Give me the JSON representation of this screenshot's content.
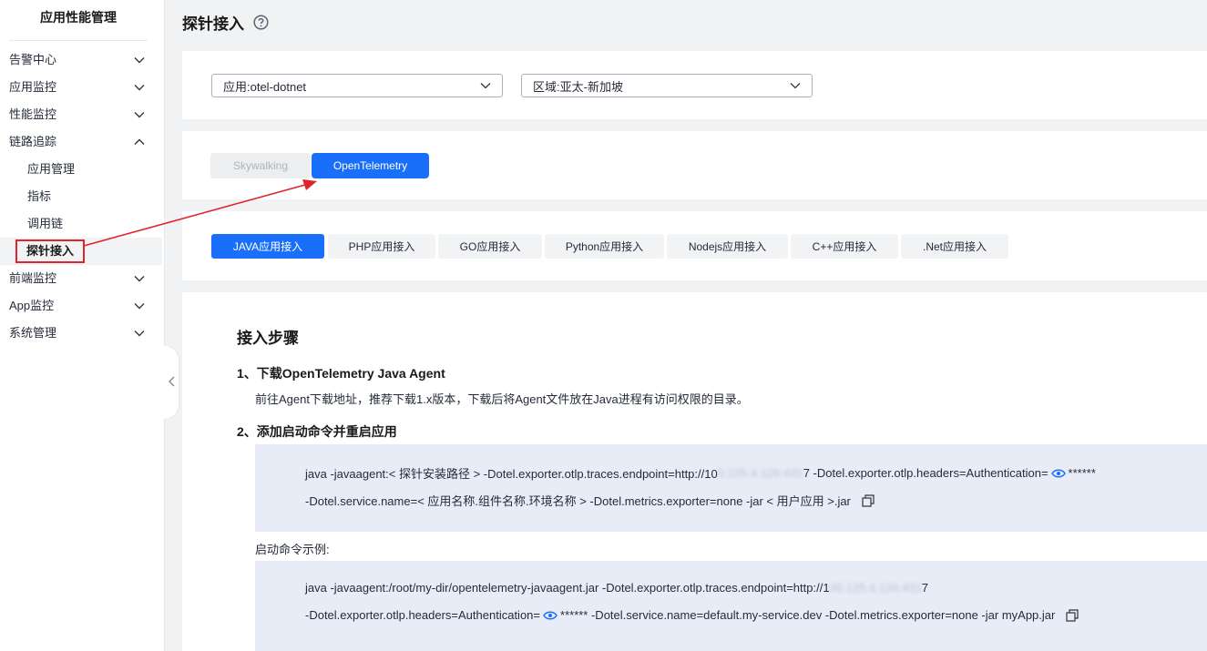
{
  "sidebar": {
    "title": "应用性能管理",
    "items": [
      {
        "label": "告警中心",
        "chevron": "down"
      },
      {
        "label": "应用监控",
        "chevron": "down"
      },
      {
        "label": "性能监控",
        "chevron": "down"
      },
      {
        "label": "链路追踪",
        "chevron": "up"
      },
      {
        "label": "应用管理",
        "sub": true
      },
      {
        "label": "指标",
        "sub": true
      },
      {
        "label": "调用链",
        "sub": true
      },
      {
        "label": "探针接入",
        "sub": true,
        "active": true
      },
      {
        "label": "前端监控",
        "chevron": "down"
      },
      {
        "label": "App监控",
        "chevron": "down"
      },
      {
        "label": "系统管理",
        "chevron": "down"
      }
    ]
  },
  "header": {
    "title": "探针接入",
    "help_icon": "question-circle-icon"
  },
  "filters": {
    "app_select": "应用:otel-dotnet",
    "region_select": "区域:亚太-新加坡"
  },
  "protocol_switch": {
    "options": [
      "Skywalking",
      "OpenTelemetry"
    ],
    "selected": "OpenTelemetry"
  },
  "language_tabs": {
    "tabs": [
      "JAVA应用接入",
      "PHP应用接入",
      "GO应用接入",
      "Python应用接入",
      "Nodejs应用接入",
      "C++应用接入",
      ".Net应用接入"
    ],
    "selected": "JAVA应用接入"
  },
  "steps": {
    "heading": "接入步骤",
    "step1_title": "1、下载OpenTelemetry Java Agent",
    "step1_desc": "前往Agent下载地址，推荐下载1.x版本，下载后将Agent文件放在Java进程有访问权限的目录。",
    "step2_title": "2、添加启动命令并重启应用",
    "cmd1_line1_a": "java -javaagent:< 探针安装路径 > -Dotel.exporter.otlp.traces.endpoint=http://10",
    "cmd1_line1_masked": "0.125.4.126:431",
    "cmd1_line1_b": "7 -Dotel.exporter.otlp.headers=Authentication=",
    "cmd1_line1_secret": "******",
    "cmd1_line2": "-Dotel.service.name=< 应用名称.组件名称.环境名称 > -Dotel.metrics.exporter=none -jar < 用户应用 >.jar",
    "example_label": "启动命令示例:",
    "cmd2_line1_a": "java -javaagent:/root/my-dir/opentelemetry-javaagent.jar -Dotel.exporter.otlp.traces.endpoint=http://1",
    "cmd2_line1_masked": "00.125.4.126:431",
    "cmd2_line1_b": "7",
    "cmd2_line2_a": "-Dotel.exporter.otlp.headers=Authentication=",
    "cmd2_line2_b": "****** -Dotel.service.name=default.my-service.dev -Dotel.metrics.exporter=none -jar myApp.jar"
  },
  "colors": {
    "primary": "#1a6ffa",
    "annotation_red": "#e0242b",
    "code_bg": "#e8ecf7",
    "page_bg": "#f1f2f4"
  }
}
